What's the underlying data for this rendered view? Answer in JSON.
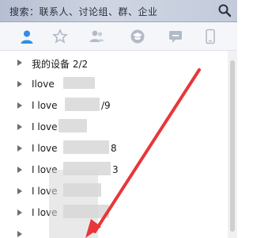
{
  "search": {
    "placeholder": "搜索：联系人、讨论组、群、企业"
  },
  "tabs": [
    {
      "icon": "contact-person-icon",
      "active": true
    },
    {
      "icon": "star-icon",
      "active": false
    },
    {
      "icon": "group-users-icon",
      "active": false
    },
    {
      "icon": "graduation-cap-icon",
      "active": false
    },
    {
      "icon": "chat-bubble-icon",
      "active": false
    },
    {
      "icon": "phone-icon",
      "active": false
    }
  ],
  "list": {
    "items": [
      {
        "label": "我的设备 2/2"
      },
      {
        "label": "Ilove"
      },
      {
        "label": "I love"
      },
      {
        "label": "I love"
      },
      {
        "label": "I love"
      },
      {
        "label": "I love"
      },
      {
        "label": "I love"
      },
      {
        "label": "I love"
      }
    ],
    "partial_counts": [
      "/9",
      "8",
      "3"
    ]
  },
  "colors": {
    "accent": "#2f8fe6",
    "tab_inactive": "#b3bac7",
    "arrow_annotation": "#e8363a"
  }
}
